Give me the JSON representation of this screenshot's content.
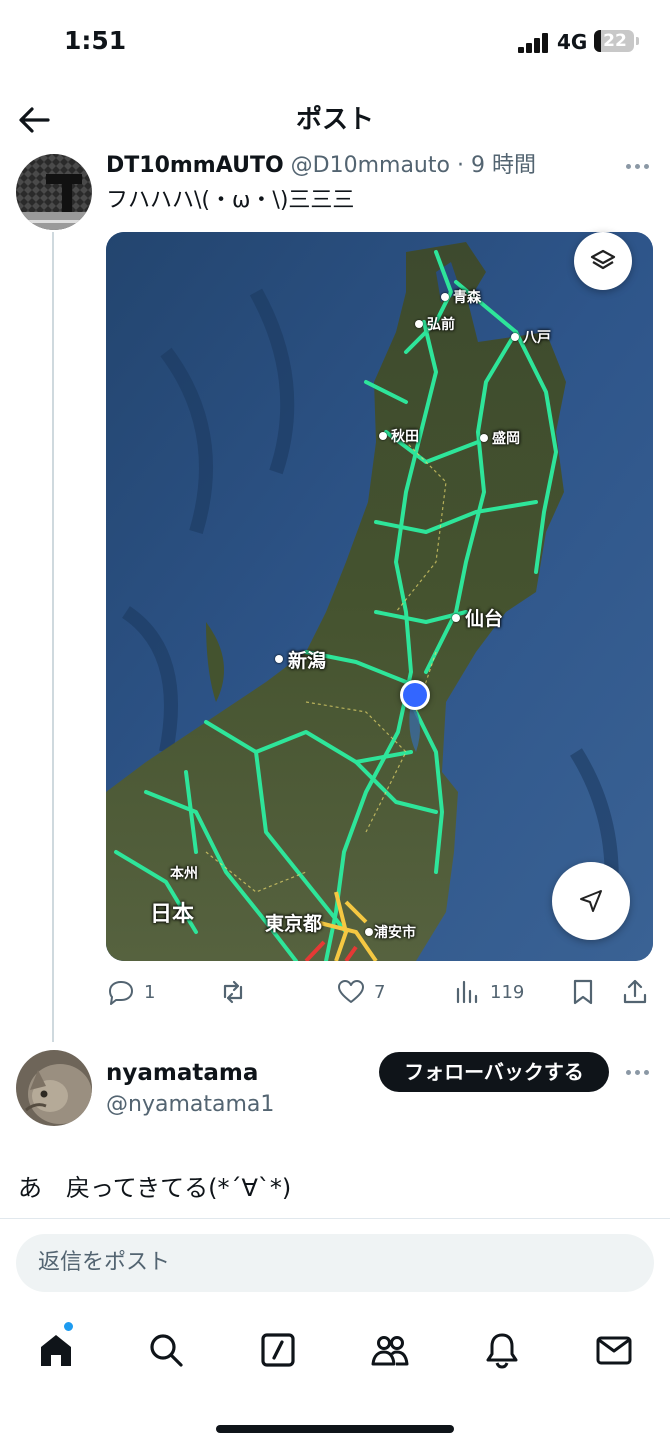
{
  "status_bar": {
    "time": "1:51",
    "network": "4G",
    "battery": "22"
  },
  "header": {
    "title": "ポスト"
  },
  "post": {
    "display_name": "DT10mmAUTO",
    "handle": "@D10mmauto",
    "separator": "·",
    "time": "9 時間",
    "text": "フハハハ\\(・ω・\\)三三三",
    "map": {
      "labels": {
        "aomori": "青森",
        "hirosaki": "弘前",
        "hachinohe": "八戸",
        "akita": "秋田",
        "morioka": "盛岡",
        "sendai": "仙台",
        "niigata": "新潟",
        "honshu": "本州",
        "nihon": "日本",
        "tokyo": "東京都",
        "urayasu": "浦安市"
      }
    },
    "actions": {
      "replies": "1",
      "reposts": "",
      "likes": "7",
      "views": "119"
    }
  },
  "reply": {
    "display_name": "nyamatama",
    "handle": "@nyamatama1",
    "follow_label": "フォローバックする",
    "text": "あ　戻ってきてる(*´∀`*)"
  },
  "compose": {
    "placeholder": "返信をポスト"
  },
  "tabs": [
    "home-icon",
    "search-icon",
    "grok-icon",
    "communities-icon",
    "notifications-icon",
    "messages-icon"
  ],
  "colors": {
    "accent": "#1d9bf0",
    "text": "#0f1419",
    "muted": "#536471",
    "road": "#2ee59a",
    "location": "#3366ff"
  }
}
